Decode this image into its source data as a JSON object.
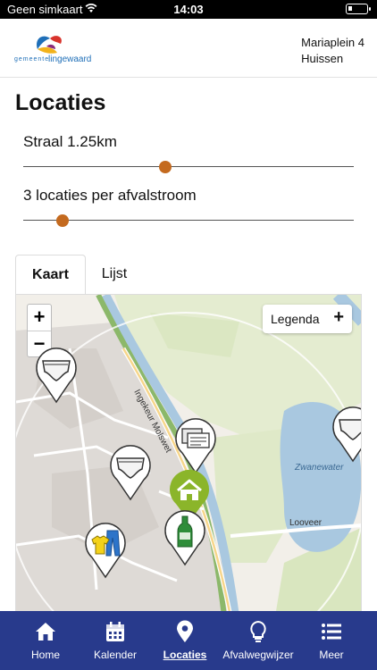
{
  "status_bar": {
    "carrier": "Geen simkaart",
    "time": "14:03"
  },
  "header": {
    "logo_text": "gemeente lingewaard",
    "address_line1": "Mariaplein 4",
    "address_line2": "Huissen"
  },
  "page": {
    "title": "Locaties"
  },
  "filters": {
    "radius_label": "Straal 1.25km",
    "radius_value": 0.43,
    "per_stream_label": "3 locaties per afvalstroom",
    "per_stream_value": 0.12
  },
  "tabs": [
    {
      "label": "Kaart",
      "active": true
    },
    {
      "label": "Lijst",
      "active": false
    }
  ],
  "map": {
    "zoom_in": "+",
    "zoom_out": "−",
    "legend_label": "Legenda",
    "legend_toggle": "+",
    "street_labels": [
      "Ingekeur Molswet",
      "Zwanewater",
      "Looveer"
    ],
    "markers": [
      "diaper-icon",
      "diaper-icon",
      "paper-icon",
      "diaper-icon",
      "home-icon",
      "glass-bottle-icon",
      "textile-icon"
    ]
  },
  "nav": [
    {
      "label": "Home",
      "icon": "home-icon",
      "active": false
    },
    {
      "label": "Kalender",
      "icon": "calendar-icon",
      "active": false
    },
    {
      "label": "Locaties",
      "icon": "location-pin-icon",
      "active": true
    },
    {
      "label": "Afvalwegwijzer",
      "icon": "lightbulb-icon",
      "active": false
    },
    {
      "label": "Meer",
      "icon": "menu-icon",
      "active": false
    }
  ],
  "colors": {
    "nav_bg": "#283a8c",
    "slider_accent": "#c46a1f",
    "home_marker": "#8bb52a"
  }
}
